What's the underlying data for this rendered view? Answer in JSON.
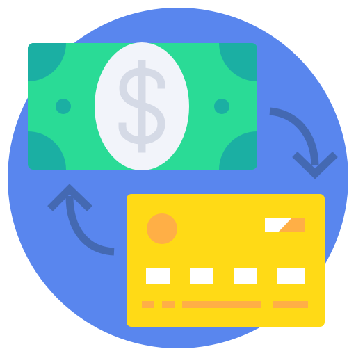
{
  "icon": {
    "name": "cash-to-card-exchange-icon",
    "colors": {
      "background_circle": "#5986EE",
      "banknote": "#2ADB96",
      "banknote_corners": "#1BAFA3",
      "banknote_oval": "#F2F4FA",
      "dollar_sign": "#D5DAE6",
      "arrows": "#4469B2",
      "card": "#FFDA16",
      "card_chip": "#FFAF46",
      "card_details": "#FFFFFF",
      "card_stripe": "#FFAF46"
    },
    "parts": [
      "background-circle",
      "banknote",
      "dollar-sign",
      "exchange-arrow-right",
      "exchange-arrow-left",
      "credit-card"
    ]
  }
}
